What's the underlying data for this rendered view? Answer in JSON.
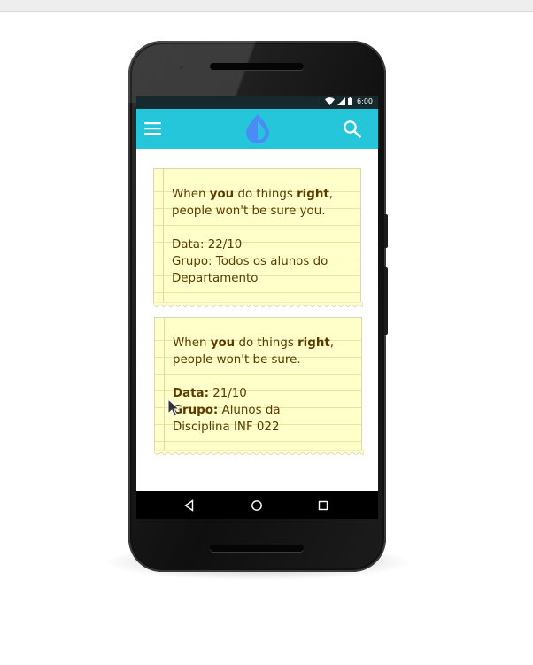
{
  "status_bar": {
    "time": "6:00",
    "icons": [
      "wifi-icon",
      "signal-icon",
      "battery-icon"
    ]
  },
  "app_bar": {
    "menu_icon": "hamburger-menu-icon",
    "logo_icon": "water-drop-logo-icon",
    "search_icon": "search-icon",
    "color": "#26c6da"
  },
  "notes": [
    {
      "text_before_you": "When ",
      "you": "you",
      "text_between": " do things ",
      "right": "right",
      "comma": ",",
      "line2": "people won't be sure you.",
      "date_label": "Data:",
      "date_value": " 22/10",
      "group_label": "Grupo:",
      "group_value_line1": " Todos os alunos do",
      "group_value_line2": "Departamento"
    },
    {
      "text_before_you": "When ",
      "you": "you",
      "text_between": " do things ",
      "right": "right",
      "comma": ",",
      "line2": "people won't be sure.",
      "date_label": "Data:",
      "date_value": " 21/10",
      "group_label": "Grupo:",
      "group_value_line1": " Alunos da",
      "group_value_line2": "Disciplina INF 022"
    }
  ],
  "nav_bar": {
    "back_icon": "back-triangle-icon",
    "home_icon": "home-circle-icon",
    "recents_icon": "recents-square-icon"
  },
  "colors": {
    "note_background": "#ffffc9",
    "note_text": "#5a3a00",
    "status_bar": "#162a2e"
  }
}
